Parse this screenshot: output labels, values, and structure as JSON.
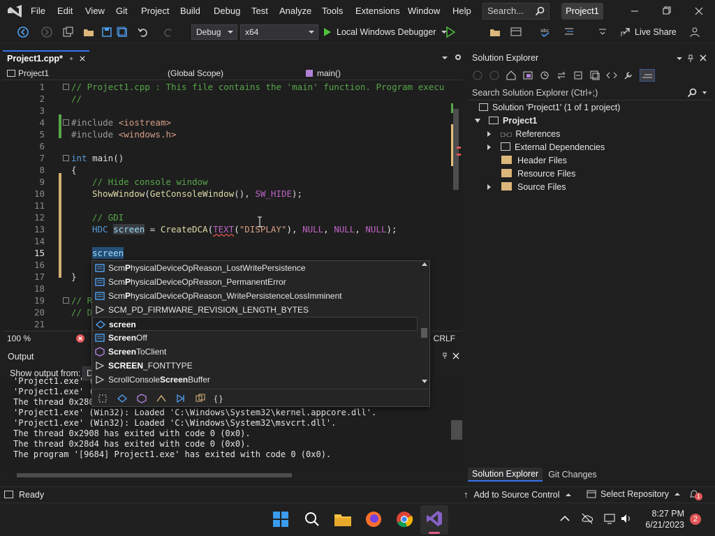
{
  "colors": {
    "accent": "#3574f0",
    "vs_purple": "#8661c5",
    "comment": "#57a64a",
    "keyword": "#569cd6",
    "macro": "#bd63c5",
    "string": "#d69d85"
  },
  "menu": [
    "File",
    "Edit",
    "View",
    "Git",
    "Project",
    "Build",
    "Debug",
    "Test",
    "Analyze",
    "Tools",
    "Extensions",
    "Window",
    "Help"
  ],
  "search": {
    "placeholder": "Search..."
  },
  "solution_badge": "Project1",
  "toolbar": {
    "config": "Debug",
    "platform": "x64",
    "debugger": "Local Windows Debugger",
    "liveshare": "Live Share"
  },
  "editor": {
    "tab_title": "Project1.cpp*",
    "nav_project": "Project1",
    "nav_scope": "(Global Scope)",
    "nav_member": "main()",
    "lines": [
      {
        "n": "1"
      },
      {
        "n": "2"
      },
      {
        "n": "3"
      },
      {
        "n": "4"
      },
      {
        "n": "5"
      },
      {
        "n": "6"
      },
      {
        "n": "7"
      },
      {
        "n": "8"
      },
      {
        "n": "9"
      },
      {
        "n": "10"
      },
      {
        "n": "11"
      },
      {
        "n": "12"
      },
      {
        "n": "13"
      },
      {
        "n": "14"
      },
      {
        "n": "15"
      },
      {
        "n": "16"
      },
      {
        "n": "17"
      },
      {
        "n": "18"
      },
      {
        "n": "19"
      },
      {
        "n": "20"
      },
      {
        "n": "21"
      }
    ],
    "code": {
      "l1": "// Project1.cpp : This file contains the 'main' function. Program execu",
      "l2": "//",
      "l4_directive": "#include",
      "l4_header": "<iostream>",
      "l5_directive": "#include",
      "l5_header": "<windows.h>",
      "l7_type": "int",
      "l7_fn": "main()",
      "l8": "{",
      "l9": "// Hide console window",
      "l10_fn": "ShowWindow",
      "l10_fn2": "GetConsoleWindow",
      "l10_args": "(), ",
      "l10_macro": "SW_HIDE",
      "l10_end": ");",
      "l12": "// GDI",
      "l13_type": "HDC",
      "l13_var": "screen",
      "l13_eq": " = ",
      "l13_fn": "CreateDCA",
      "l13_macro": "TEXT",
      "l13_str": "\"DISPLAY\"",
      "l13_null1": "NULL",
      "l13_null2": "NULL",
      "l13_null3": "NULL",
      "l15": "screen",
      "l17": "}",
      "l19": "// R",
      "l20": "// D"
    },
    "zoom": "100 %",
    "line_ending": "CRLF"
  },
  "intellisense": {
    "items": [
      {
        "pre": "Scm",
        "bold": "P",
        "rest": "hysicalDeviceOpReason_LostWritePersistence"
      },
      {
        "pre": "Scm",
        "bold": "P",
        "rest": "hysicalDeviceOpReason_PermanentError"
      },
      {
        "pre": "Scm",
        "bold": "P",
        "rest": "hysicalDeviceOpReason_WritePersistenceLossImminent"
      },
      {
        "pre": "SCM_PD_FIRMWARE_REVISION_LENGTH_BYTES",
        "bold": "",
        "rest": ""
      },
      {
        "pre": "",
        "bold": "screen",
        "rest": ""
      },
      {
        "pre": "",
        "bold": "Screen",
        "rest": "Off"
      },
      {
        "pre": "",
        "bold": "Screen",
        "rest": "ToClient"
      },
      {
        "pre": "",
        "bold": "SCREEN",
        "rest": "_FONTTYPE"
      },
      {
        "pre": "ScrollConsole",
        "bold": "Screen",
        "rest": "Buffer"
      }
    ],
    "filter_braces": "{ }"
  },
  "output": {
    "title": "Output",
    "show_from_label": "Show output from:",
    "show_from_value": "D",
    "lines": [
      "'Project1.exe' (",
      "'Project1.exe' (",
      "The thread 0x280",
      "'Project1.exe' (Win32): Loaded 'C:\\Windows\\System32\\kernel.appcore.dll'.",
      "'Project1.exe' (Win32): Loaded 'C:\\Windows\\System32\\msvcrt.dll'.",
      "The thread 0x2908 has exited with code 0 (0x0).",
      "The thread 0x28d4 has exited with code 0 (0x0).",
      "The program '[9684] Project1.exe' has exited with code 0 (0x0)."
    ]
  },
  "solution_explorer": {
    "title": "Solution Explorer",
    "search_placeholder": "Search Solution Explorer (Ctrl+;)",
    "solution": "Solution 'Project1' (1 of 1 project)",
    "project": "Project1",
    "nodes": [
      "References",
      "External Dependencies",
      "Header Files",
      "Resource Files",
      "Source Files"
    ],
    "tab_solution": "Solution Explorer",
    "tab_git": "Git Changes"
  },
  "status": {
    "ready": "Ready",
    "add_source": "Add to Source Control",
    "select_repo": "Select Repository",
    "notifications": "1"
  },
  "taskbar": {
    "time": "8:27 PM",
    "date": "6/21/2023",
    "badge": "2"
  }
}
